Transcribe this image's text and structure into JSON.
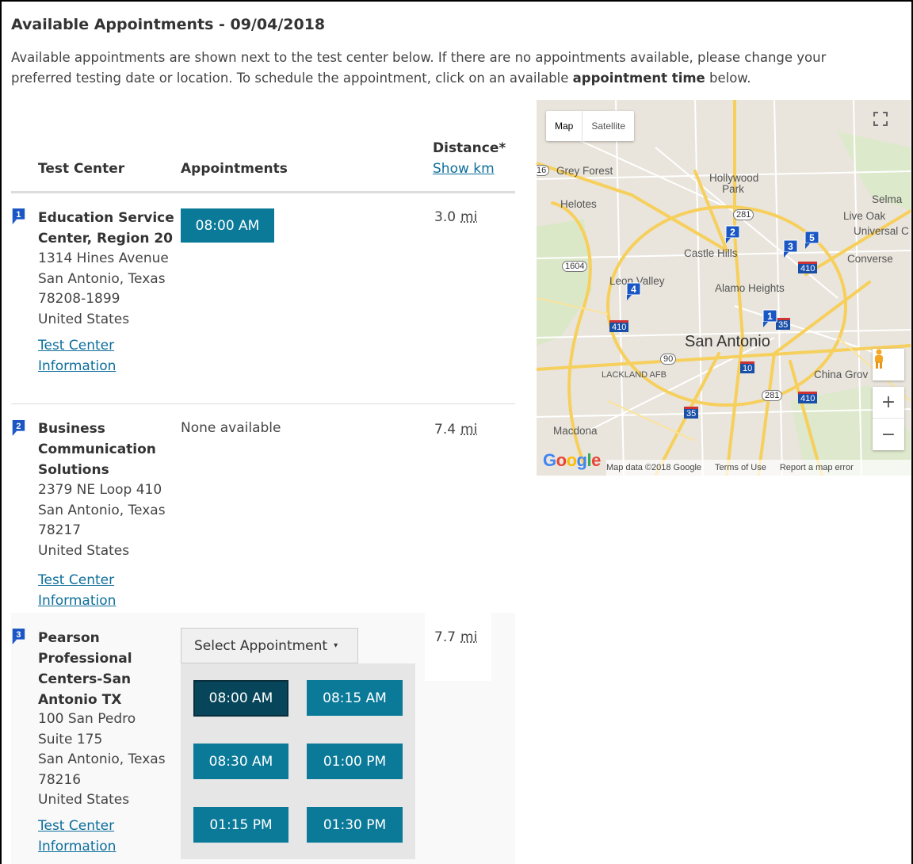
{
  "page": {
    "title": "Available Appointments - 09/04/2018",
    "intro_part1": "Available appointments are shown next to the test center below. If there are no appointments available, please change your preferred testing date or location. To schedule the appointment, click on an available ",
    "intro_bold": "appointment time",
    "intro_part2": " below."
  },
  "table": {
    "col_test_center": "Test Center",
    "col_appointments": "Appointments",
    "col_distance": "Distance*",
    "show_km": "Show km"
  },
  "centers": [
    {
      "marker": "1",
      "name": "Education Service Center, Region 20",
      "address": [
        "1314 Hines Avenue",
        "San Antonio, Texas",
        "78208-1899",
        "United States"
      ],
      "link": "Test Center Information",
      "appointments": [
        "08:00 AM"
      ],
      "distance": "3.0",
      "unit": "mi"
    },
    {
      "marker": "2",
      "name": "Business Communication Solutions",
      "address": [
        "2379 NE Loop 410",
        "San Antonio, Texas",
        "78217",
        "United States"
      ],
      "link": "Test Center Information",
      "none_text": "None available",
      "distance": "7.4",
      "unit": "mi"
    },
    {
      "marker": "3",
      "name": "Pearson Professional Centers-San Antonio TX",
      "address": [
        "100 San Pedro",
        "Suite 175",
        "San Antonio, Texas",
        "78216",
        "United States"
      ],
      "link": "Test Center Information",
      "dropdown_label": "Select Appointment",
      "appointments": [
        "08:00 AM",
        "08:15 AM",
        "08:30 AM",
        "01:00 PM",
        "01:15 PM",
        "01:30 PM"
      ],
      "selected_appointment": "08:00 AM",
      "distance": "7.7",
      "unit": "mi"
    }
  ],
  "map": {
    "type_map": "Map",
    "type_satellite": "Satellite",
    "labels": {
      "grey_forest": "Grey Forest",
      "hollywood_park": "Hollywood Park",
      "selma": "Selma",
      "helotes": "Helotes",
      "live_oak": "Live Oak",
      "universal": "Universal C",
      "castle_hills": "Castle Hills",
      "converse": "Converse",
      "leon_valley": "Leon Valley",
      "alamo_heights": "Alamo Heights",
      "san_antonio": "San Antonio",
      "lackland": "LACKLAND AFB",
      "china_grove": "China Grov",
      "macdonald": "Macdona"
    },
    "shields": [
      "1604",
      "281",
      "410",
      "410",
      "35",
      "90",
      "10",
      "281",
      "410",
      "35",
      "16"
    ],
    "markers": [
      "1",
      "2",
      "3",
      "4",
      "5"
    ],
    "google": "Google",
    "footer_data": "Map data ©2018 Google",
    "footer_terms": "Terms of Use",
    "footer_report": "Report a map error",
    "zoom_in": "+",
    "zoom_out": "−"
  },
  "colors": {
    "button": "#0b7a99",
    "button_selected": "#07465a",
    "link": "#0d6e9a",
    "marker": "#1a56c4"
  }
}
